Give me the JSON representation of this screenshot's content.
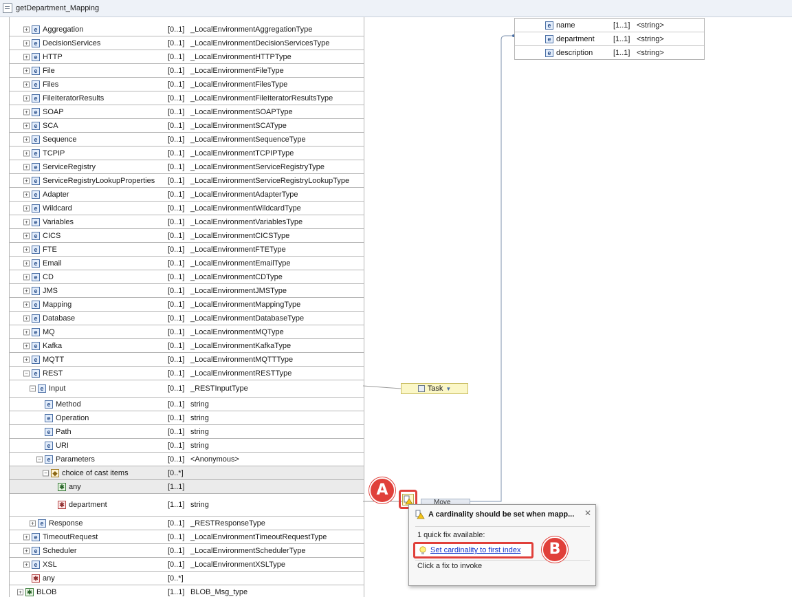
{
  "window": {
    "title": "getDepartment_Mapping"
  },
  "source_tree": {
    "rows": [
      {
        "name": "Aggregation",
        "card": "[0..1]",
        "type": "_LocalEnvironmentAggregationType"
      },
      {
        "name": "DecisionServices",
        "card": "[0..1]",
        "type": "_LocalEnvironmentDecisionServicesType"
      },
      {
        "name": "HTTP",
        "card": "[0..1]",
        "type": "_LocalEnvironmentHTTPType"
      },
      {
        "name": "File",
        "card": "[0..1]",
        "type": "_LocalEnvironmentFileType"
      },
      {
        "name": "Files",
        "card": "[0..1]",
        "type": "_LocalEnvironmentFilesType"
      },
      {
        "name": "FileIteratorResults",
        "card": "[0..1]",
        "type": "_LocalEnvironmentFileIteratorResultsType"
      },
      {
        "name": "SOAP",
        "card": "[0..1]",
        "type": "_LocalEnvironmentSOAPType"
      },
      {
        "name": "SCA",
        "card": "[0..1]",
        "type": "_LocalEnvironmentSCAType"
      },
      {
        "name": "Sequence",
        "card": "[0..1]",
        "type": "_LocalEnvironmentSequenceType"
      },
      {
        "name": "TCPIP",
        "card": "[0..1]",
        "type": "_LocalEnvironmentTCPIPType"
      },
      {
        "name": "ServiceRegistry",
        "card": "[0..1]",
        "type": "_LocalEnvironmentServiceRegistryType"
      },
      {
        "name": "ServiceRegistryLookupProperties",
        "card": "[0..1]",
        "type": "_LocalEnvironmentServiceRegistryLookupType"
      },
      {
        "name": "Adapter",
        "card": "[0..1]",
        "type": "_LocalEnvironmentAdapterType"
      },
      {
        "name": "Wildcard",
        "card": "[0..1]",
        "type": "_LocalEnvironmentWildcardType"
      },
      {
        "name": "Variables",
        "card": "[0..1]",
        "type": "_LocalEnvironmentVariablesType"
      },
      {
        "name": "CICS",
        "card": "[0..1]",
        "type": "_LocalEnvironmentCICSType"
      },
      {
        "name": "FTE",
        "card": "[0..1]",
        "type": "_LocalEnvironmentFTEType"
      },
      {
        "name": "Email",
        "card": "[0..1]",
        "type": "_LocalEnvironmentEmailType"
      },
      {
        "name": "CD",
        "card": "[0..1]",
        "type": "_LocalEnvironmentCDType"
      },
      {
        "name": "JMS",
        "card": "[0..1]",
        "type": "_LocalEnvironmentJMSType"
      },
      {
        "name": "Mapping",
        "card": "[0..1]",
        "type": "_LocalEnvironmentMappingType"
      },
      {
        "name": "Database",
        "card": "[0..1]",
        "type": "_LocalEnvironmentDatabaseType"
      },
      {
        "name": "MQ",
        "card": "[0..1]",
        "type": "_LocalEnvironmentMQType"
      },
      {
        "name": "Kafka",
        "card": "[0..1]",
        "type": "_LocalEnvironmentKafkaType"
      },
      {
        "name": "MQTT",
        "card": "[0..1]",
        "type": "_LocalEnvironmentMQTTType"
      },
      {
        "name": "REST",
        "card": "[0..1]",
        "type": "_LocalEnvironmentRESTType"
      },
      {
        "name": "Input",
        "card": "[0..1]",
        "type": "_RESTInputType"
      },
      {
        "name": "Method",
        "card": "[0..1]",
        "type": "string"
      },
      {
        "name": "Operation",
        "card": "[0..1]",
        "type": "string"
      },
      {
        "name": "Path",
        "card": "[0..1]",
        "type": "string"
      },
      {
        "name": "URI",
        "card": "[0..1]",
        "type": "string"
      },
      {
        "name": "Parameters",
        "card": "[0..1]",
        "type": "<Anonymous>"
      },
      {
        "name": "choice of cast items",
        "card": "[0..*]",
        "type": ""
      },
      {
        "name": "any",
        "card": "[1..1]",
        "type": ""
      },
      {
        "name": "department",
        "card": "[1..1]",
        "type": "string"
      },
      {
        "name": "Response",
        "card": "[0..1]",
        "type": "_RESTResponseType"
      },
      {
        "name": "TimeoutRequest",
        "card": "[0..1]",
        "type": "_LocalEnvironmentTimeoutRequestType"
      },
      {
        "name": "Scheduler",
        "card": "[0..1]",
        "type": "_LocalEnvironmentSchedulerType"
      },
      {
        "name": "XSL",
        "card": "[0..1]",
        "type": "_LocalEnvironmentXSLType"
      },
      {
        "name": "any",
        "card": "[0..*]",
        "type": ""
      },
      {
        "name": "BLOB",
        "card": "[1..1]",
        "type": "BLOB_Msg_type"
      }
    ]
  },
  "target_tree": {
    "rows": [
      {
        "name": "name",
        "card": "[1..1]",
        "type": "<string>"
      },
      {
        "name": "department",
        "card": "[1..1]",
        "type": "<string>"
      },
      {
        "name": "description",
        "card": "[1..1]",
        "type": "<string>"
      }
    ]
  },
  "transforms": {
    "task_label": "Task",
    "move_label": "Move"
  },
  "annotations": {
    "marker_a": "A",
    "marker_b": "B"
  },
  "quickfix": {
    "title": "A cardinality should be set when mapp...",
    "count": "1 quick fix available:",
    "fix_label": "Set cardinality to first index",
    "hint": "Click a fix to invoke",
    "close_glyph": "✕"
  },
  "colors": {
    "marker": "#e0403a",
    "link": "#1033cc",
    "task_bg": "#fbf7c7"
  }
}
